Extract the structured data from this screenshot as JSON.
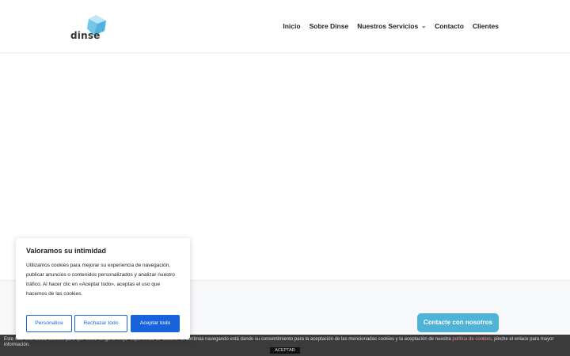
{
  "header": {
    "logo_text": "dinse",
    "nav": [
      {
        "label": "Inicio"
      },
      {
        "label": "Sobre Dinse"
      },
      {
        "label": "Nuestros Servicios",
        "has_dropdown": true
      },
      {
        "label": "Contacto"
      },
      {
        "label": "Clientes"
      }
    ]
  },
  "cta": {
    "label": "Contacte con nosotros"
  },
  "consent_modal": {
    "title": "Valoramos su intimidad",
    "body": "Utilizamos cookies para mejorar su experiencia de navegación, publicar anuncios o contenidos personalizados y analizar nuestro tráfico. Al hacer clic en «Aceptar todo», aceptas el uso que hacemos de las cookies.",
    "customize_label": "Personalice",
    "reject_label": "Rechazar todo",
    "accept_label": "Aceptar todo"
  },
  "cookie_bar": {
    "text": "Este sitio web utiliza cookies para que usted tenga la mejor experiencia de usuario. Si continúa navegando está dando su consentimiento para la aceptación de las mencionadas cookies y la aceptación de nuestra ",
    "link_text": "política de cookies",
    "text_after": ", pinche el enlace para mayor información.",
    "accept_label": "ACEPTAR"
  },
  "colors": {
    "accent_blue": "#1863dc",
    "cta_blue": "#4eb3d6",
    "logo_blue": "#6fc4e6",
    "cookie_bar_bg": "#3b3b3b",
    "link_pink": "#ef8f8f"
  }
}
